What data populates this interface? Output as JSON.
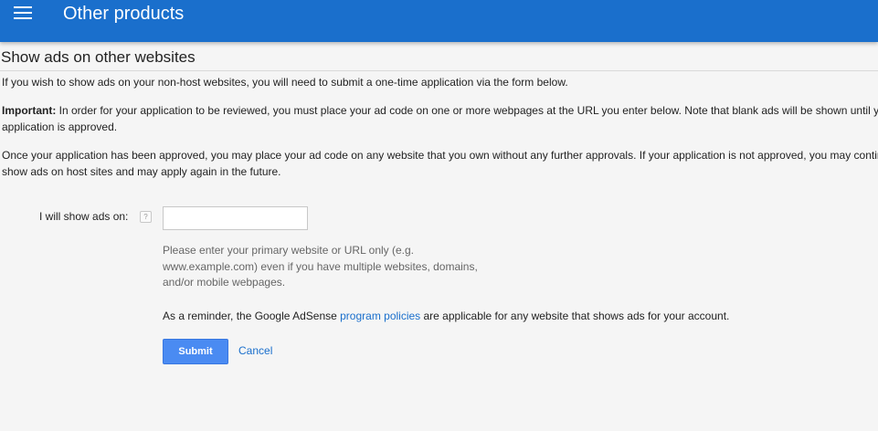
{
  "appbar": {
    "menu_icon": "menu-icon",
    "title": "Other products",
    "color": "#1a6fcc"
  },
  "page": {
    "heading": "Show ads on other websites",
    "paragraphs": {
      "p1": "If you wish to show ads on your non-host websites, you will need to submit a one-time application via the form below.",
      "p2_bold": "Important:",
      "p2_rest": " In order for your application to be reviewed, you must place your ad code on one or more webpages at the URL you enter below. Note that blank ads will be shown until your application is approved.",
      "p3": "Once your application has been approved, you may place your ad code on any website that you own without any further approvals. If your application is not approved, you may continue to show ads on host sites and may apply again in the future."
    }
  },
  "form": {
    "label": "I will show ads on:",
    "help_icon": "question-mark-icon",
    "help_symbol": "?",
    "input_value": "",
    "hint": "Please enter your primary website or URL only (e.g. www.example.com) even if you have multiple websites, domains, and/or mobile webpages.",
    "reminder_before": "As a reminder, the Google AdSense ",
    "reminder_link": "program policies",
    "reminder_after": " are applicable for any website that shows ads for your account.",
    "submit_label": "Submit",
    "cancel_label": "Cancel",
    "submit_color": "#4a8bf2",
    "link_color": "#1a6fcc"
  }
}
